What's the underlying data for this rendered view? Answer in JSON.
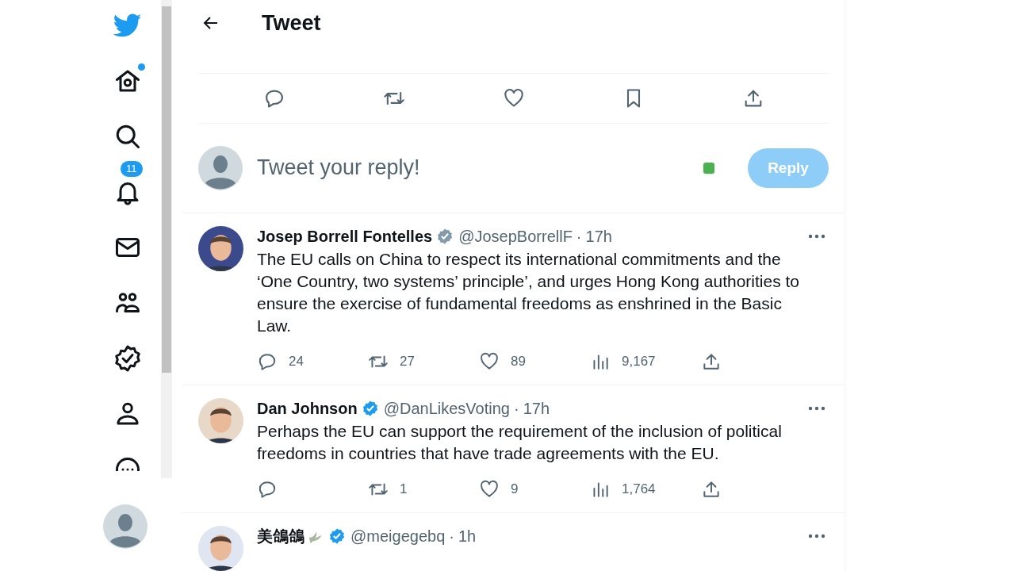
{
  "nav": {
    "items": [
      {
        "kind": "home",
        "dot": true
      },
      {
        "kind": "search"
      },
      {
        "kind": "notifications",
        "badge": "11"
      },
      {
        "kind": "messages"
      },
      {
        "kind": "communities"
      },
      {
        "kind": "verified"
      },
      {
        "kind": "profile"
      },
      {
        "kind": "more"
      }
    ]
  },
  "header": {
    "title": "Tweet"
  },
  "composer": {
    "placeholder": "Tweet your reply!",
    "button": "Reply",
    "disabled": true
  },
  "replies": [
    {
      "name": "Josep Borrell Fontelles",
      "color": "#829aab",
      "handle": "@JosepBorrellF",
      "separator": "·",
      "time": "17h",
      "text": "The EU calls on China to respect its international commitments and the ‘One Country, two systems’ principle’, and urges Hong Kong authorities to ensure the exercise of fundamental freedoms as enshrined in the Basic Law.",
      "replies": "24",
      "retweets": "27",
      "likes": "89",
      "views": "9,167"
    },
    {
      "name": "Dan Johnson",
      "color": "#1d9bf0",
      "handle": "@DanLikesVoting",
      "separator": "·",
      "time": "17h",
      "text": "Perhaps the EU can support the requirement of the inclusion of political freedoms in countries that have trade agreements with the EU.",
      "retweets": "1",
      "likes": "9",
      "views": "1,764"
    },
    {
      "name": "美鴿鴿",
      "dove": true,
      "color": "#1d9bf0",
      "handle": "@meigegebq",
      "separator": "·",
      "time": "1h"
    }
  ]
}
